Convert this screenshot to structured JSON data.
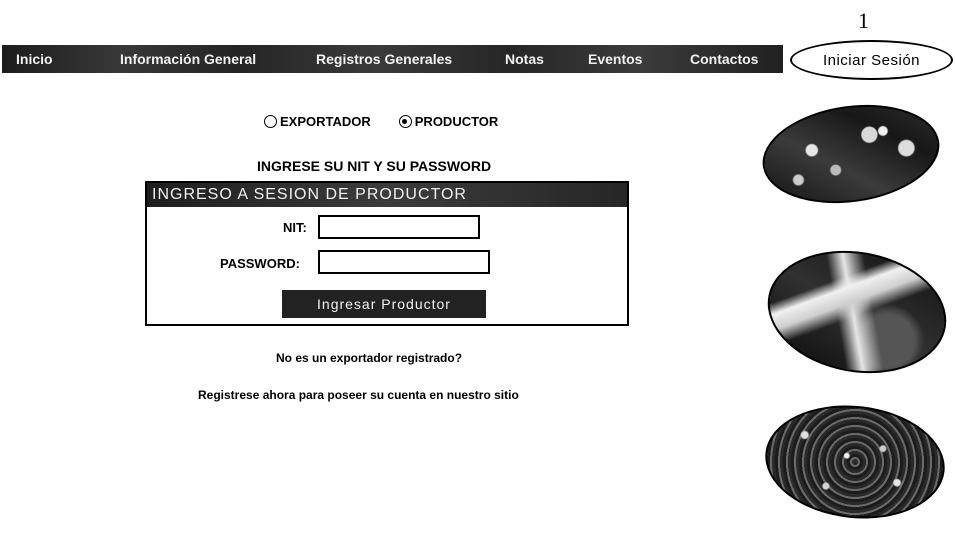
{
  "page_number": "1",
  "nav": {
    "items": [
      "Inicio",
      "Información General",
      "Registros Generales",
      "Notas",
      "Eventos",
      "Contactos"
    ],
    "login_label": "Iniciar Sesión"
  },
  "user_type": {
    "options": [
      "EXPORTADOR",
      "PRODUCTOR"
    ],
    "selected": "PRODUCTOR"
  },
  "prompt": "INGRESE SU NIT Y SU PASSWORD",
  "login_form": {
    "title": "INGRESO A SESION DE PRODUCTOR",
    "nit_label": "NIT:",
    "nit_value": "",
    "password_label": "PASSWORD:",
    "password_value": "",
    "submit_label": "Ingresar Productor"
  },
  "footer": {
    "question": "No es un exportador registrado?",
    "register_text": "Registrese ahora para poseer su cuenta en nuestro sitio"
  },
  "images": [
    "coffee-photo",
    "coffee-photo",
    "coffee-photo"
  ]
}
